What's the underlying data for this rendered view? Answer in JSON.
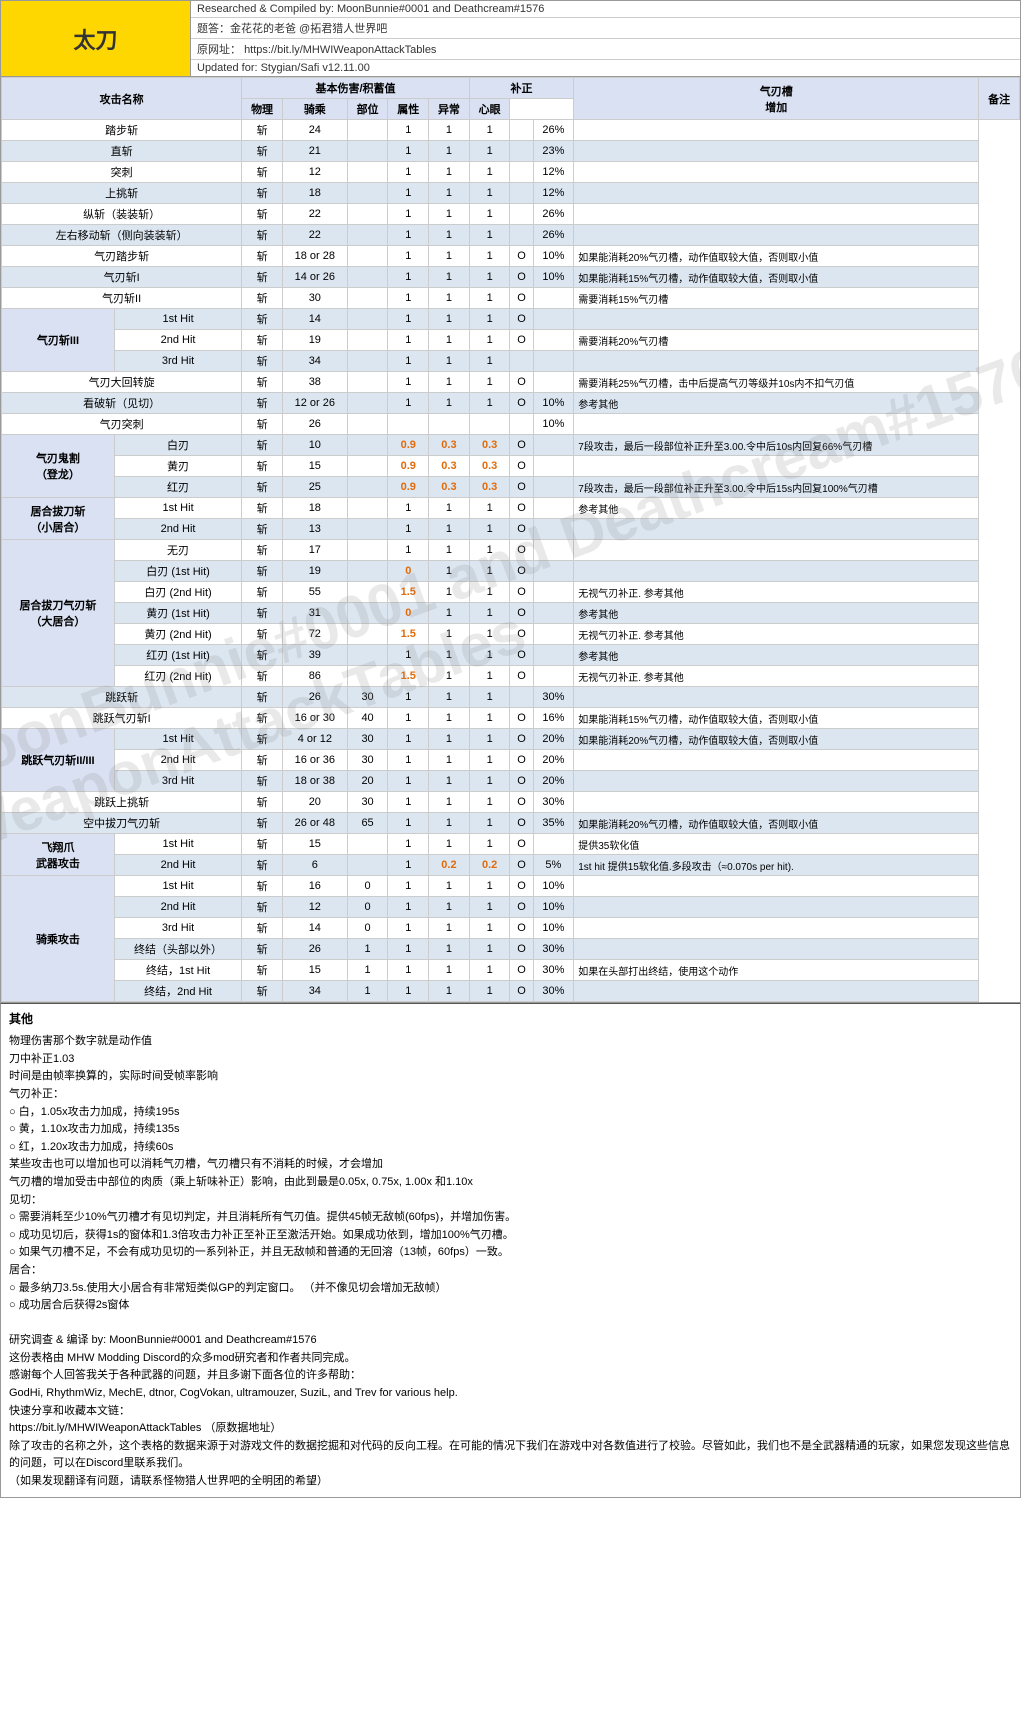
{
  "header": {
    "title": "太刀",
    "top_credit": "Researched & Compiled by: MoonBunnie#0001 and Deathcream#1576",
    "community": "题答：金花花的老爸 @拓君猎人世界吧",
    "website_label": "原网址：",
    "website": "https://bit.ly/MHWIWeaponAttackTables",
    "updated": "Updated for: Stygian/Safi v12.11.00"
  },
  "col_headers": {
    "attack_name": "攻击名称",
    "basic_dmg": "基本伤害/积蓄值",
    "physical": "物理",
    "riding": "骑乘",
    "part": "部位",
    "attribute": "属性",
    "abnormal": "异常",
    "heart": "心眼",
    "correction": "补正",
    "ki_boost": "气刃槽增加",
    "notes": "备注"
  },
  "watermark": "MoonBunnie#0001 and Deathcream#1576\nWeaponAttackTables",
  "rows": [
    {
      "type": "normal",
      "group": "",
      "name": "踏步斩",
      "ki": "斩",
      "physical": "24",
      "riding": "",
      "part": "1",
      "attribute": "1",
      "abnormal": "1",
      "heart": "",
      "ki_boost": "26%",
      "notes": ""
    },
    {
      "type": "normal",
      "group": "",
      "name": "直斩",
      "ki": "斩",
      "physical": "21",
      "riding": "",
      "part": "1",
      "attribute": "1",
      "abnormal": "1",
      "heart": "",
      "ki_boost": "23%",
      "notes": ""
    },
    {
      "type": "normal",
      "group": "",
      "name": "突刺",
      "ki": "斩",
      "physical": "12",
      "riding": "",
      "part": "1",
      "attribute": "1",
      "abnormal": "1",
      "heart": "",
      "ki_boost": "12%",
      "notes": ""
    },
    {
      "type": "normal",
      "group": "",
      "name": "上挑斩",
      "ki": "斩",
      "physical": "18",
      "riding": "",
      "part": "1",
      "attribute": "1",
      "abnormal": "1",
      "heart": "",
      "ki_boost": "12%",
      "notes": ""
    },
    {
      "type": "normal",
      "group": "",
      "name": "纵斩（装装斩）",
      "ki": "斩",
      "physical": "22",
      "riding": "",
      "part": "1",
      "attribute": "1",
      "abnormal": "1",
      "heart": "",
      "ki_boost": "26%",
      "notes": ""
    },
    {
      "type": "normal",
      "group": "",
      "name": "左右移动斩（侧向装装斩）",
      "ki": "斩",
      "physical": "22",
      "riding": "",
      "part": "1",
      "attribute": "1",
      "abnormal": "1",
      "heart": "",
      "ki_boost": "26%",
      "notes": ""
    },
    {
      "type": "normal",
      "group": "",
      "name": "气刃踏步斩",
      "ki": "斩",
      "physical": "18 or 28",
      "riding": "",
      "part": "1",
      "attribute": "1",
      "abnormal": "1",
      "heart": "O",
      "ki_boost": "10%",
      "notes": "如果能消耗20%气刃槽，动作值取较大值，否则取小值"
    },
    {
      "type": "normal",
      "group": "",
      "name": "气刃斩I",
      "ki": "斩",
      "physical": "14 or 26",
      "riding": "",
      "part": "1",
      "attribute": "1",
      "abnormal": "1",
      "heart": "O",
      "ki_boost": "10%",
      "notes": "如果能消耗15%气刃槽，动作值取较大值，否则取小值"
    },
    {
      "type": "normal",
      "group": "",
      "name": "气刃斩II",
      "ki": "斩",
      "physical": "30",
      "riding": "",
      "part": "1",
      "attribute": "1",
      "abnormal": "1",
      "heart": "O",
      "ki_boost": "",
      "notes": "需要消耗15%气刃槽"
    },
    {
      "type": "subgroup",
      "group": "气刃斩III",
      "subname": "1st Hit",
      "ki": "斩",
      "physical": "14",
      "riding": "",
      "part": "1",
      "attribute": "1",
      "abnormal": "1",
      "heart": "O",
      "ki_boost": "",
      "notes": ""
    },
    {
      "type": "subgroup",
      "group": "气刃斩III",
      "subname": "2nd Hit",
      "ki": "斩",
      "physical": "19",
      "riding": "",
      "part": "1",
      "attribute": "1",
      "abnormal": "1",
      "heart": "O",
      "ki_boost": "",
      "notes": "需要消耗20%气刃槽"
    },
    {
      "type": "subgroup",
      "group": "气刃斩III",
      "subname": "3rd Hit",
      "ki": "斩",
      "physical": "34",
      "riding": "",
      "part": "1",
      "attribute": "1",
      "abnormal": "1",
      "heart": "",
      "ki_boost": "",
      "notes": ""
    },
    {
      "type": "normal",
      "group": "",
      "name": "气刃大回转旋",
      "ki": "斩",
      "physical": "38",
      "riding": "",
      "part": "1",
      "attribute": "1",
      "abnormal": "1",
      "heart": "O",
      "ki_boost": "",
      "notes": "需要消耗25%气刃槽，击中后提高气刃等级并10s内不扣气刃值"
    },
    {
      "type": "normal",
      "group": "",
      "name": "看破斩（见切）",
      "ki": "斩",
      "physical": "12 or 26",
      "riding": "",
      "part": "1",
      "attribute": "1",
      "abnormal": "1",
      "heart": "O",
      "ki_boost": "10%",
      "notes": "参考其他"
    },
    {
      "type": "normal",
      "group": "",
      "name": "气刃突刺",
      "ki": "斩",
      "physical": "26",
      "riding": "",
      "part": "",
      "attribute": "",
      "abnormal": "",
      "heart": "",
      "ki_boost": "10%",
      "notes": ""
    },
    {
      "type": "subgroup2",
      "group": "气刃鬼割\n（登龙）",
      "subname": "白刃",
      "ki": "斩",
      "physical": "10",
      "riding": "",
      "part": "0.9",
      "attribute": "0.3",
      "abnormal": "0.3",
      "heart": "O",
      "ki_boost": "",
      "notes": "7段攻击，最后一段部位补正升至3.00.令中后10s内回复66%气刃槽"
    },
    {
      "type": "subgroup2",
      "group": "气刃鬼割\n（登龙）",
      "subname": "黄刃",
      "ki": "斩",
      "physical": "15",
      "riding": "",
      "part": "0.9",
      "attribute": "0.3",
      "abnormal": "0.3",
      "heart": "O",
      "ki_boost": "",
      "notes": ""
    },
    {
      "type": "subgroup2",
      "group": "气刃鬼割\n（登龙）",
      "subname": "红刃",
      "ki": "斩",
      "physical": "25",
      "riding": "",
      "part": "0.9",
      "attribute": "0.3",
      "abnormal": "0.3",
      "heart": "O",
      "ki_boost": "",
      "notes": "7段攻击，最后一段部位补正升至3.00.令中后15s内回复100%气刃槽"
    },
    {
      "type": "subgroup",
      "group": "居合拔刀斩\n（小居合）",
      "subname": "1st Hit",
      "ki": "斩",
      "physical": "18",
      "riding": "",
      "part": "1",
      "attribute": "1",
      "abnormal": "1",
      "heart": "O",
      "ki_boost": "",
      "notes": "参考其他"
    },
    {
      "type": "subgroup",
      "group": "居合拔刀斩\n（小居合）",
      "subname": "2nd Hit",
      "ki": "斩",
      "physical": "13",
      "riding": "",
      "part": "1",
      "attribute": "1",
      "abnormal": "1",
      "heart": "O",
      "ki_boost": "",
      "notes": ""
    },
    {
      "type": "subgroup3",
      "group": "居合拔刀气刃斩\n（大居合）",
      "subname": "无刃",
      "ki": "斩",
      "physical": "17",
      "riding": "",
      "part": "1",
      "attribute": "1",
      "abnormal": "1",
      "heart": "O",
      "ki_boost": "",
      "notes": ""
    },
    {
      "type": "subgroup3",
      "group": "居合拔刀气刃斩\n（大居合）",
      "subname": "白刃 (1st Hit)",
      "ki": "斩",
      "physical": "19",
      "riding": "",
      "part": "0",
      "attribute": "1",
      "abnormal": "1",
      "heart": "O",
      "ki_boost": "",
      "notes": ""
    },
    {
      "type": "subgroup3",
      "group": "居合拔刀气刃斩\n（大居合）",
      "subname": "白刃 (2nd Hit)",
      "ki": "斩",
      "physical": "55",
      "riding": "",
      "part": "1.5",
      "attribute": "1",
      "abnormal": "1",
      "heart": "O",
      "ki_boost": "",
      "notes": "无视气刃补正. 参考其他"
    },
    {
      "type": "subgroup3",
      "group": "居合拔刀气刃斩\n（大居合）",
      "subname": "黄刃 (1st Hit)",
      "ki": "斩",
      "physical": "31",
      "riding": "",
      "part": "0",
      "attribute": "1",
      "abnormal": "1",
      "heart": "O",
      "ki_boost": "",
      "notes": "参考其他"
    },
    {
      "type": "subgroup3",
      "group": "居合拔刀气刃斩\n（大居合）",
      "subname": "黄刃 (2nd Hit)",
      "ki": "斩",
      "physical": "72",
      "riding": "",
      "part": "1.5",
      "attribute": "1",
      "abnormal": "1",
      "heart": "O",
      "ki_boost": "",
      "notes": "无视气刃补正. 参考其他"
    },
    {
      "type": "subgroup3",
      "group": "居合拔刀气刃斩\n（大居合）",
      "subname": "红刃 (1st Hit)",
      "ki": "斩",
      "physical": "39",
      "riding": "",
      "part": "1",
      "attribute": "1",
      "abnormal": "1",
      "heart": "O",
      "ki_boost": "",
      "notes": "参考其他"
    },
    {
      "type": "subgroup3",
      "group": "居合拔刀气刃斩\n（大居合）",
      "subname": "红刃 (2nd Hit)",
      "ki": "斩",
      "physical": "86",
      "riding": "",
      "part": "1.5",
      "attribute": "1",
      "abnormal": "1",
      "heart": "O",
      "ki_boost": "",
      "notes": "无视气刃补正. 参考其他"
    },
    {
      "type": "normal",
      "group": "",
      "name": "跳跃斩",
      "ki": "斩",
      "physical": "26",
      "riding": "30",
      "part": "1",
      "attribute": "1",
      "abnormal": "1",
      "heart": "",
      "ki_boost": "30%",
      "notes": ""
    },
    {
      "type": "normal",
      "group": "",
      "name": "跳跃气刃斩I",
      "ki": "斩",
      "physical": "16 or 30",
      "riding": "40",
      "part": "1",
      "attribute": "1",
      "abnormal": "1",
      "heart": "O",
      "ki_boost": "16%",
      "notes": "如果能消耗15%气刃槽，动作值取较大值，否则取小值"
    },
    {
      "type": "subgroup",
      "group": "跳跃气刃斩II/III",
      "subname": "1st Hit",
      "ki": "斩",
      "physical": "4 or 12",
      "riding": "30",
      "part": "1",
      "attribute": "1",
      "abnormal": "1",
      "heart": "O",
      "ki_boost": "20%",
      "notes": "如果能消耗20%气刃槽，动作值取较大值，否则取小值"
    },
    {
      "type": "subgroup",
      "group": "跳跃气刃斩II/III",
      "subname": "2nd Hit",
      "ki": "斩",
      "physical": "16 or 36",
      "riding": "30",
      "part": "1",
      "attribute": "1",
      "abnormal": "1",
      "heart": "O",
      "ki_boost": "20%",
      "notes": ""
    },
    {
      "type": "subgroup",
      "group": "跳跃气刃斩II/III",
      "subname": "3rd Hit",
      "ki": "斩",
      "physical": "18 or 38",
      "riding": "20",
      "part": "1",
      "attribute": "1",
      "abnormal": "1",
      "heart": "O",
      "ki_boost": "20%",
      "notes": ""
    },
    {
      "type": "normal",
      "group": "",
      "name": "跳跃上挑斩",
      "ki": "斩",
      "physical": "20",
      "riding": "30",
      "part": "1",
      "attribute": "1",
      "abnormal": "1",
      "heart": "O",
      "ki_boost": "30%",
      "notes": ""
    },
    {
      "type": "normal",
      "group": "",
      "name": "空中拔刀气刃斩",
      "ki": "斩",
      "physical": "26 or 48",
      "riding": "65",
      "part": "1",
      "attribute": "1",
      "abnormal": "1",
      "heart": "O",
      "ki_boost": "35%",
      "notes": "如果能消耗20%气刃槽，动作值取较大值，否则取小值"
    },
    {
      "type": "subgroup",
      "group": "飞翔爪\n武器攻击",
      "subname": "1st Hit",
      "ki": "斩",
      "physical": "15",
      "riding": "",
      "part": "1",
      "attribute": "1",
      "abnormal": "1",
      "heart": "O",
      "ki_boost": "",
      "notes": "提供35软化值"
    },
    {
      "type": "subgroup",
      "group": "飞翔爪\n武器攻击",
      "subname": "2nd Hit",
      "ki": "斩",
      "physical": "6",
      "riding": "",
      "part": "1",
      "attribute": "0.2",
      "abnormal": "0.2",
      "heart": "O",
      "ki_boost": "5%",
      "notes": "1st hit 提供15软化值.多段攻击（≈0.070s per hit)."
    },
    {
      "type": "subgroup",
      "group": "骑乘攻击",
      "subname": "1st Hit",
      "ki": "斩",
      "physical": "16",
      "riding": "0",
      "part": "1",
      "attribute": "1",
      "abnormal": "1",
      "heart": "O",
      "ki_boost": "10%",
      "notes": ""
    },
    {
      "type": "subgroup",
      "group": "骑乘攻击",
      "subname": "2nd Hit",
      "ki": "斩",
      "physical": "12",
      "riding": "0",
      "part": "1",
      "attribute": "1",
      "abnormal": "1",
      "heart": "O",
      "ki_boost": "10%",
      "notes": ""
    },
    {
      "type": "subgroup",
      "group": "骑乘攻击",
      "subname": "3rd Hit",
      "ki": "斩",
      "physical": "14",
      "riding": "0",
      "part": "1",
      "attribute": "1",
      "abnormal": "1",
      "heart": "O",
      "ki_boost": "10%",
      "notes": ""
    },
    {
      "type": "subgroup",
      "group": "骑乘攻击",
      "subname": "终结（头部以外）",
      "ki": "斩",
      "physical": "26",
      "riding": "1",
      "part": "1",
      "attribute": "1",
      "abnormal": "1",
      "heart": "O",
      "ki_boost": "30%",
      "notes": ""
    },
    {
      "type": "subgroup",
      "group": "骑乘攻击",
      "subname": "终结，1st Hit",
      "ki": "斩",
      "physical": "15",
      "riding": "1",
      "part": "1",
      "attribute": "1",
      "abnormal": "1",
      "heart": "O",
      "ki_boost": "30%",
      "notes": "如果在头部打出终结，使用这个动作"
    },
    {
      "type": "subgroup",
      "group": "骑乘攻击",
      "subname": "终结，2nd Hit",
      "ki": "斩",
      "physical": "34",
      "riding": "1",
      "part": "1",
      "attribute": "1",
      "abnormal": "1",
      "heart": "O",
      "ki_boost": "30%",
      "notes": ""
    }
  ],
  "footer": {
    "section_title": "其他",
    "notes": [
      "物理伤害那个数字就是动作值",
      "刀中补正1.03",
      "时间是由帧率换算的，实际时间受帧率影响",
      "气刃补正：",
      "○ 白，1.05x攻击力加成，持续195s",
      "○ 黄，1.10x攻击力加成，持续135s",
      "○ 红，1.20x攻击力加成，持续60s",
      "某些攻击也可以增加也可以消耗气刃槽，气刃槽只有不消耗的时候，才会增加",
      "气刃槽的增加受击中部位的肉质（乘上斩味补正）影响，由此到最是0.05x, 0.75x, 1.00x 和1.10x",
      "见切：",
      "○ 需要消耗至少10%气刃槽才有见切判定，并且消耗所有气刃值。提供45帧无敌帧(60fps)，并增加伤害。",
      "○ 成功见切后，获得1s的窗体和1.3倍攻击力补正至补正至激活开始。如果成功依到，增加100%气刃槽。",
      "○ 如果气刃槽不足，不会有成功见切的一系列补正，并且无敌帧和普通的无回溶（13帧，60fps）一致。",
      "居合：",
      "○ 最多纳刀3.5s.使用大小居合有非常短类似GP的判定窗口。 （并不像见切会增加无敌帧）",
      "○ 成功居合后获得2s窗体"
    ],
    "credits": [
      "研究调查 & 编译 by: MoonBunnie#0001 and Deathcream#1576",
      "这份表格由 MHW Modding Discord的众多mod研究者和作者共同完成。",
      "感谢每个人回答我关于各种武器的问题，并且多谢下面各位的许多帮助：",
      "GodHi, RhythmWiz, MechE, dtnor, CogVokan, ultramouzer, SuziL, and Trev for various help.",
      "",
      "快速分享和收藏本文链：",
      "https://bit.ly/MHWIWeaponAttackTables （原数据地址）",
      "除了攻击的名称之外，这个表格的数据来源于对游戏文件的数据挖掘和对代码的反向工程。在可能的情况下我们在游戏中对各数值进行了校验。尽管如此，我们也不是全武器精通的玩家，如果您发现这些信息的问题，可以在Discord里联系我们。",
      "（如果发现翻译有问题，请联系怪物猎人世界吧的全明团的希望）"
    ]
  }
}
